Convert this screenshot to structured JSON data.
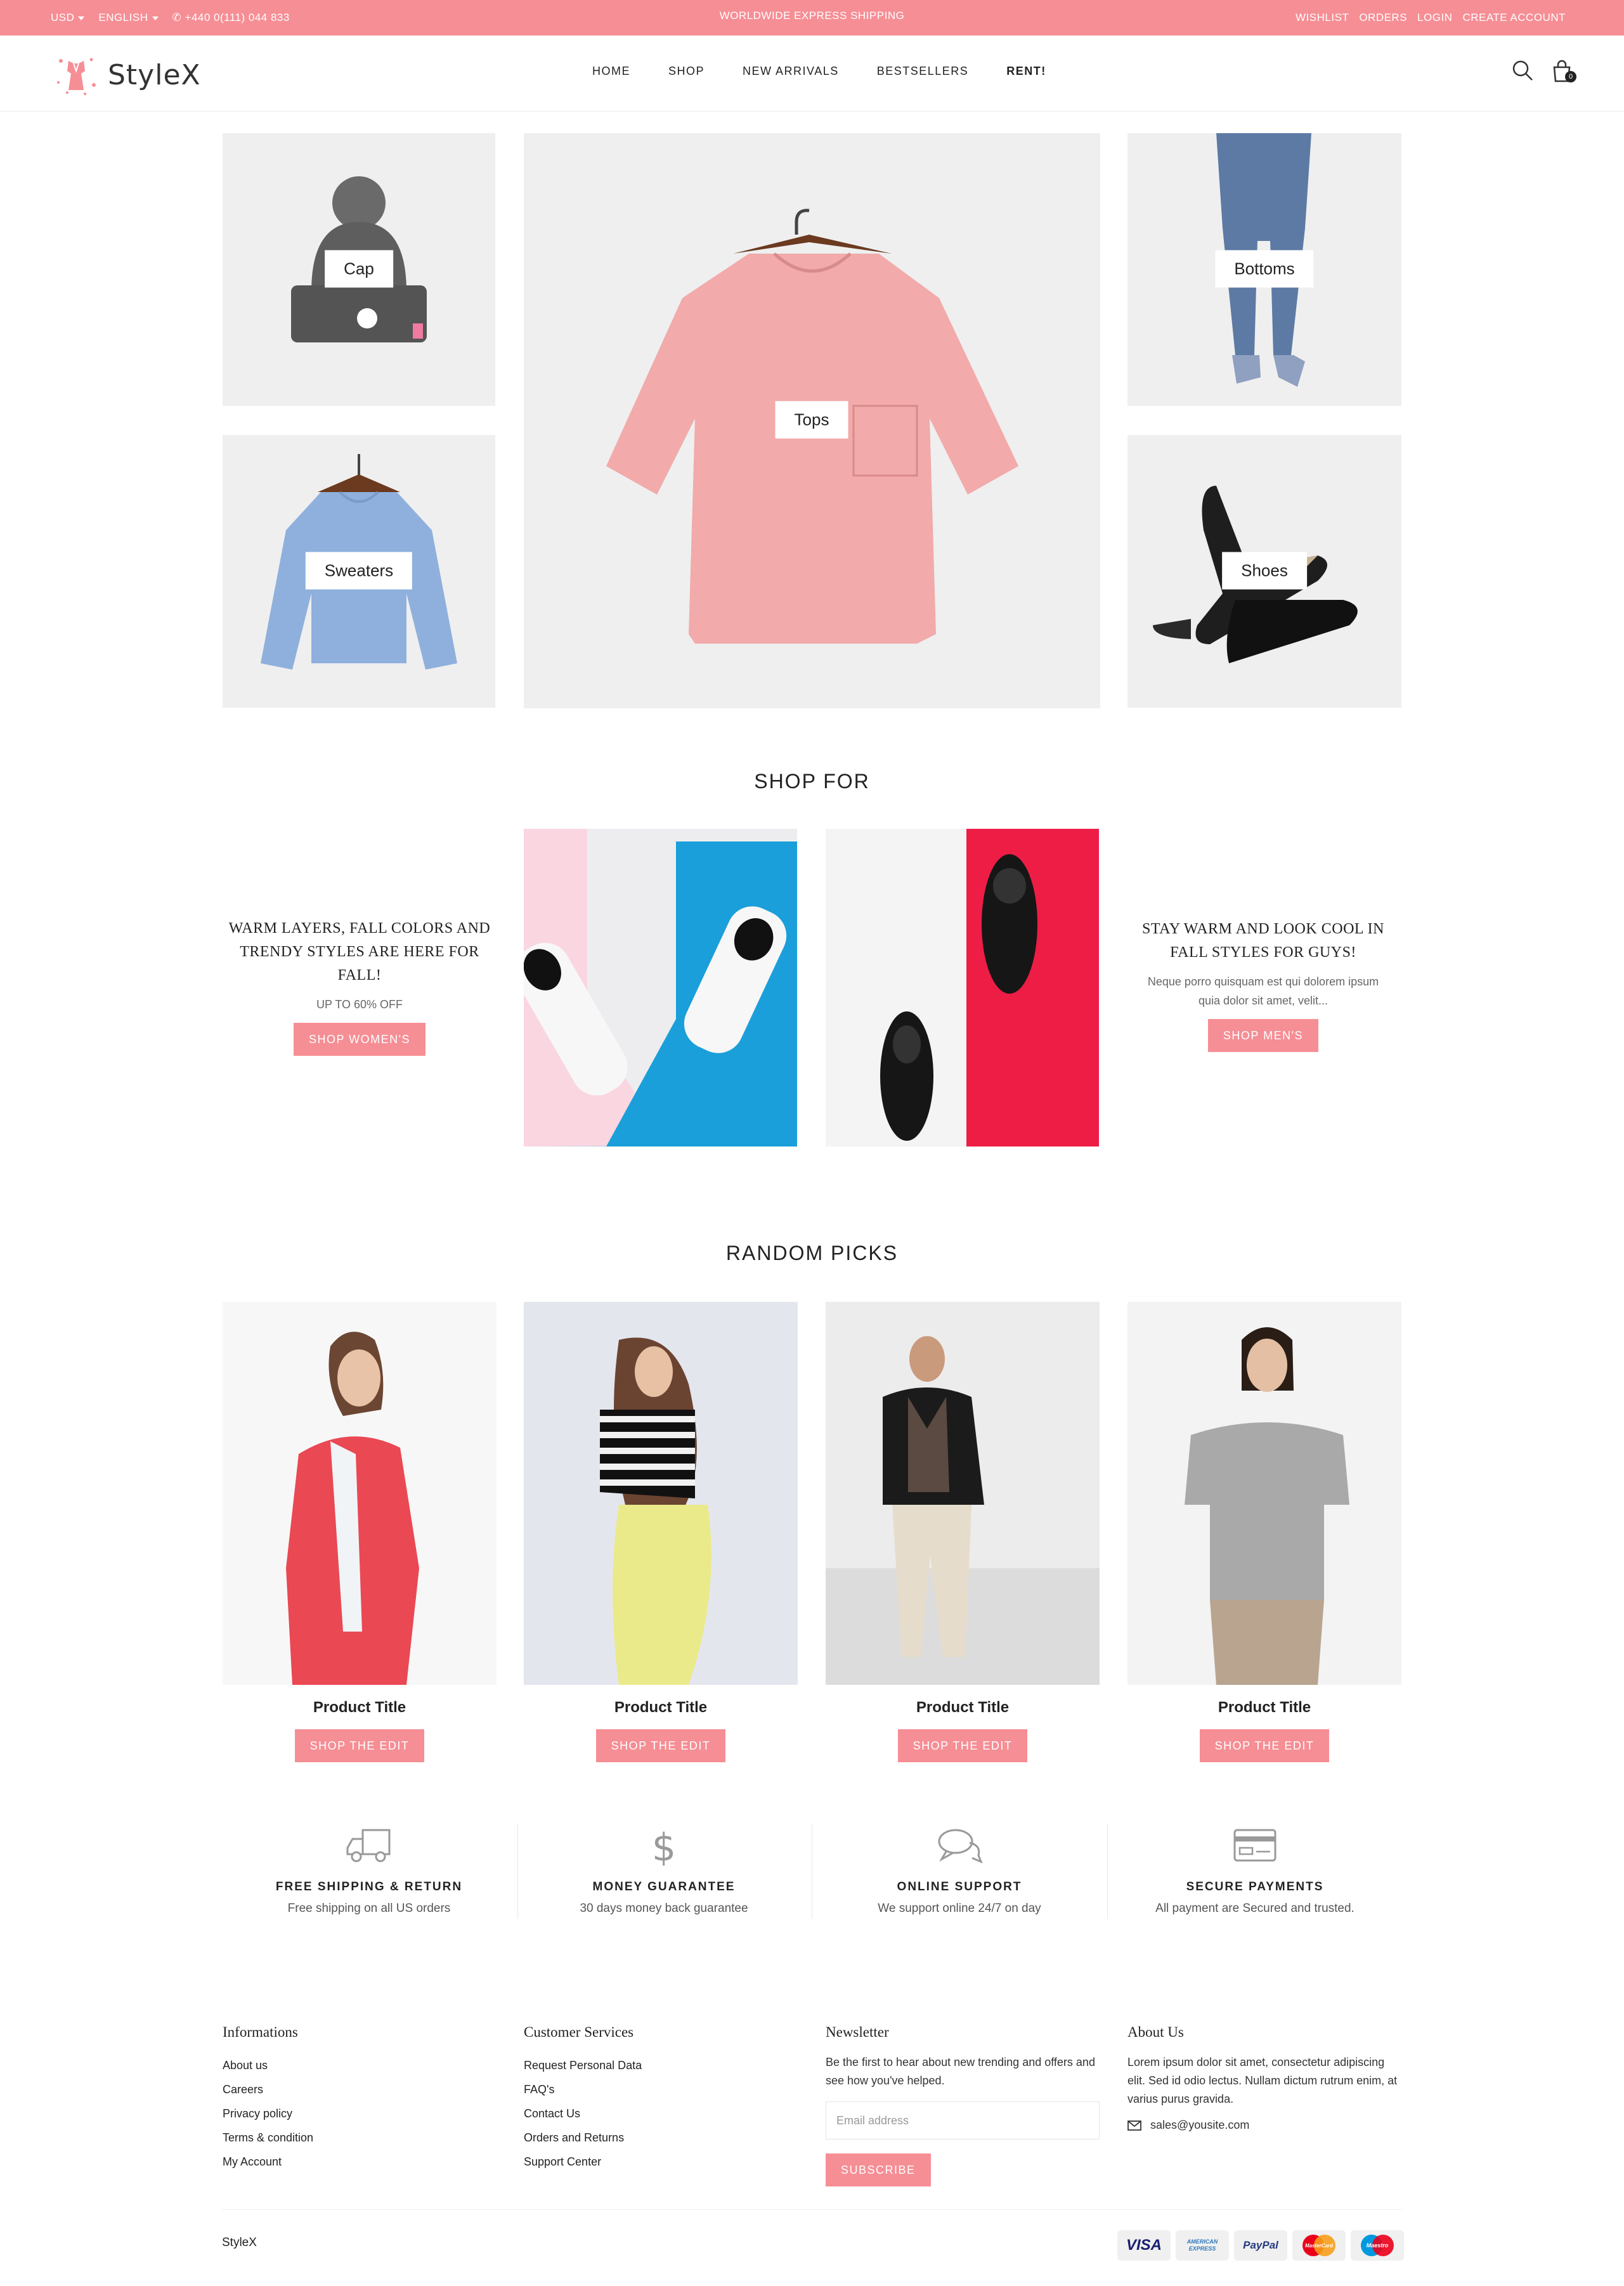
{
  "topbar": {
    "currency": "USD",
    "language": "ENGLISH",
    "phone": "+440 0(111) 044 833",
    "shipping": "WORLDWIDE EXPRESS SHIPPING",
    "links": [
      "WISHLIST",
      "ORDERS",
      "LOGIN",
      "CREATE ACCOUNT"
    ]
  },
  "header": {
    "logo_text": "StyleX",
    "nav": [
      "HOME",
      "SHOP",
      "NEW ARRIVALS",
      "BESTSELLERS",
      "RENT!"
    ],
    "cart_count": "0"
  },
  "categories": {
    "cap": "Cap",
    "tops": "Tops",
    "bottoms": "Bottoms",
    "sweaters": "Sweaters",
    "shoes": "Shoes"
  },
  "shop_for": {
    "title": "SHOP FOR",
    "women": {
      "heading": "WARM LAYERS, FALL COLORS AND TRENDY STYLES ARE HERE FOR FALL!",
      "subtext": "UP TO 60% OFF",
      "button": "SHOP WOMEN'S"
    },
    "men": {
      "heading": "STAY WARM AND LOOK COOL IN FALL STYLES FOR GUYS!",
      "subtext": "Neque porro quisquam est qui dolorem ipsum quia dolor sit amet, velit...",
      "button": "SHOP MEN'S"
    }
  },
  "random_picks": {
    "title": "RANDOM PICKS",
    "products": [
      {
        "title": "Product Title",
        "button": "SHOP THE EDIT"
      },
      {
        "title": "Product Title",
        "button": "SHOP THE EDIT"
      },
      {
        "title": "Product Title",
        "button": "SHOP THE EDIT"
      },
      {
        "title": "Product Title",
        "button": "SHOP THE EDIT"
      }
    ]
  },
  "features": [
    {
      "icon": "truck-icon",
      "title": "FREE SHIPPING & RETURN",
      "desc": "Free shipping on all US orders"
    },
    {
      "icon": "dollar-icon",
      "title": "MONEY GUARANTEE",
      "desc": "30 days money back guarantee"
    },
    {
      "icon": "chat-icon",
      "title": "ONLINE SUPPORT",
      "desc": "We support online 24/7 on day"
    },
    {
      "icon": "payment-card-icon",
      "title": "SECURE PAYMENTS",
      "desc": "All payment are Secured and trusted."
    }
  ],
  "footer": {
    "informations": {
      "title": "Informations",
      "links": [
        "About us",
        "Careers",
        "Privacy policy",
        "Terms & condition",
        "My Account"
      ]
    },
    "customer_services": {
      "title": "Customer Services",
      "links": [
        "Request Personal Data",
        "FAQ's",
        "Contact Us",
        "Orders and Returns",
        "Support Center"
      ]
    },
    "newsletter": {
      "title": "Newsletter",
      "text": "Be the first to hear about new trending and offers and see how you've helped.",
      "placeholder": "Email address",
      "button": "SUBSCRIBE"
    },
    "about": {
      "title": "About Us",
      "text": "Lorem ipsum dolor sit amet, consectetur adipiscing elit. Sed id odio lectus. Nullam dictum rutrum enim, at varius purus gravida.",
      "email": "sales@yousite.com"
    },
    "copyright": "StyleX",
    "payments": [
      "VISA",
      "AMERICAN EXPRESS",
      "PayPal",
      "MasterCard",
      "Maestro"
    ]
  },
  "colors": {
    "accent": "#f68e95",
    "tile_bg": "#efefef"
  }
}
